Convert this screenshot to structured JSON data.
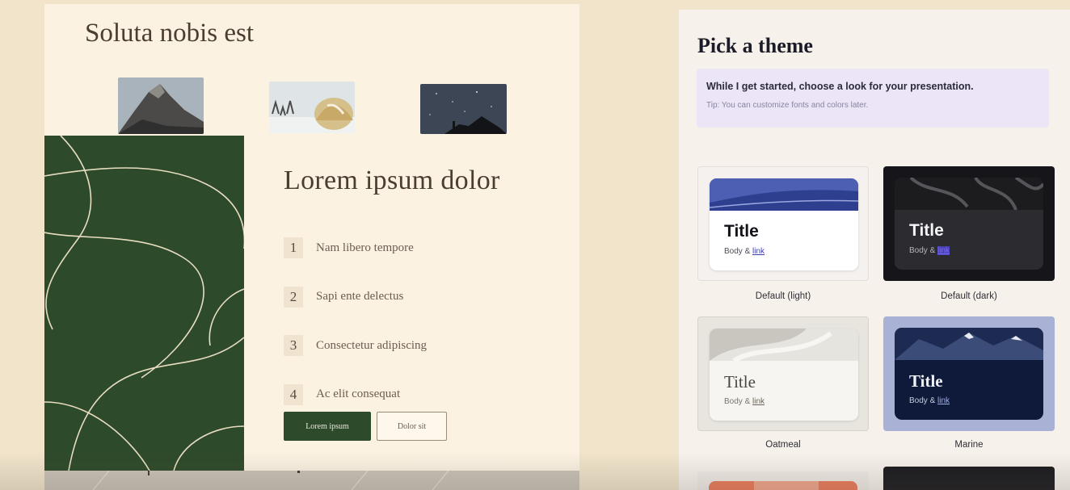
{
  "slide": {
    "title": "Soluta nobis est",
    "heading": "Lorem ipsum dolor",
    "items": [
      {
        "num": "1",
        "label": "Nam libero tempore"
      },
      {
        "num": "2",
        "label": "Sapi ente delectus"
      },
      {
        "num": "3",
        "label": "Consectetur adipiscing"
      },
      {
        "num": "4",
        "label": "Ac elit consequat"
      }
    ],
    "primary_button": "Lorem ipsum",
    "secondary_button": "Dolor sit",
    "colors": {
      "panel": "#2d4a2a",
      "background": "#fbf2e2"
    }
  },
  "theme_picker": {
    "title": "Pick a theme",
    "info": "While I get started, choose a look for your presentation.",
    "tip": "Tip: You can customize fonts and colors later.",
    "themes": [
      {
        "name": "Default (light)",
        "title": "Title",
        "body": "Body & ",
        "link": "link",
        "accent": "#2f3f8f"
      },
      {
        "name": "Default (dark)",
        "title": "Title",
        "body": "Body & ",
        "link": "link",
        "accent": "#5b4be0"
      },
      {
        "name": "Oatmeal",
        "title": "Title",
        "body": "Body & ",
        "link": "link",
        "accent": "#6b6357"
      },
      {
        "name": "Marine",
        "title": "Title",
        "body": "Body & ",
        "link": "link",
        "accent": "#0f1a3a"
      }
    ]
  }
}
